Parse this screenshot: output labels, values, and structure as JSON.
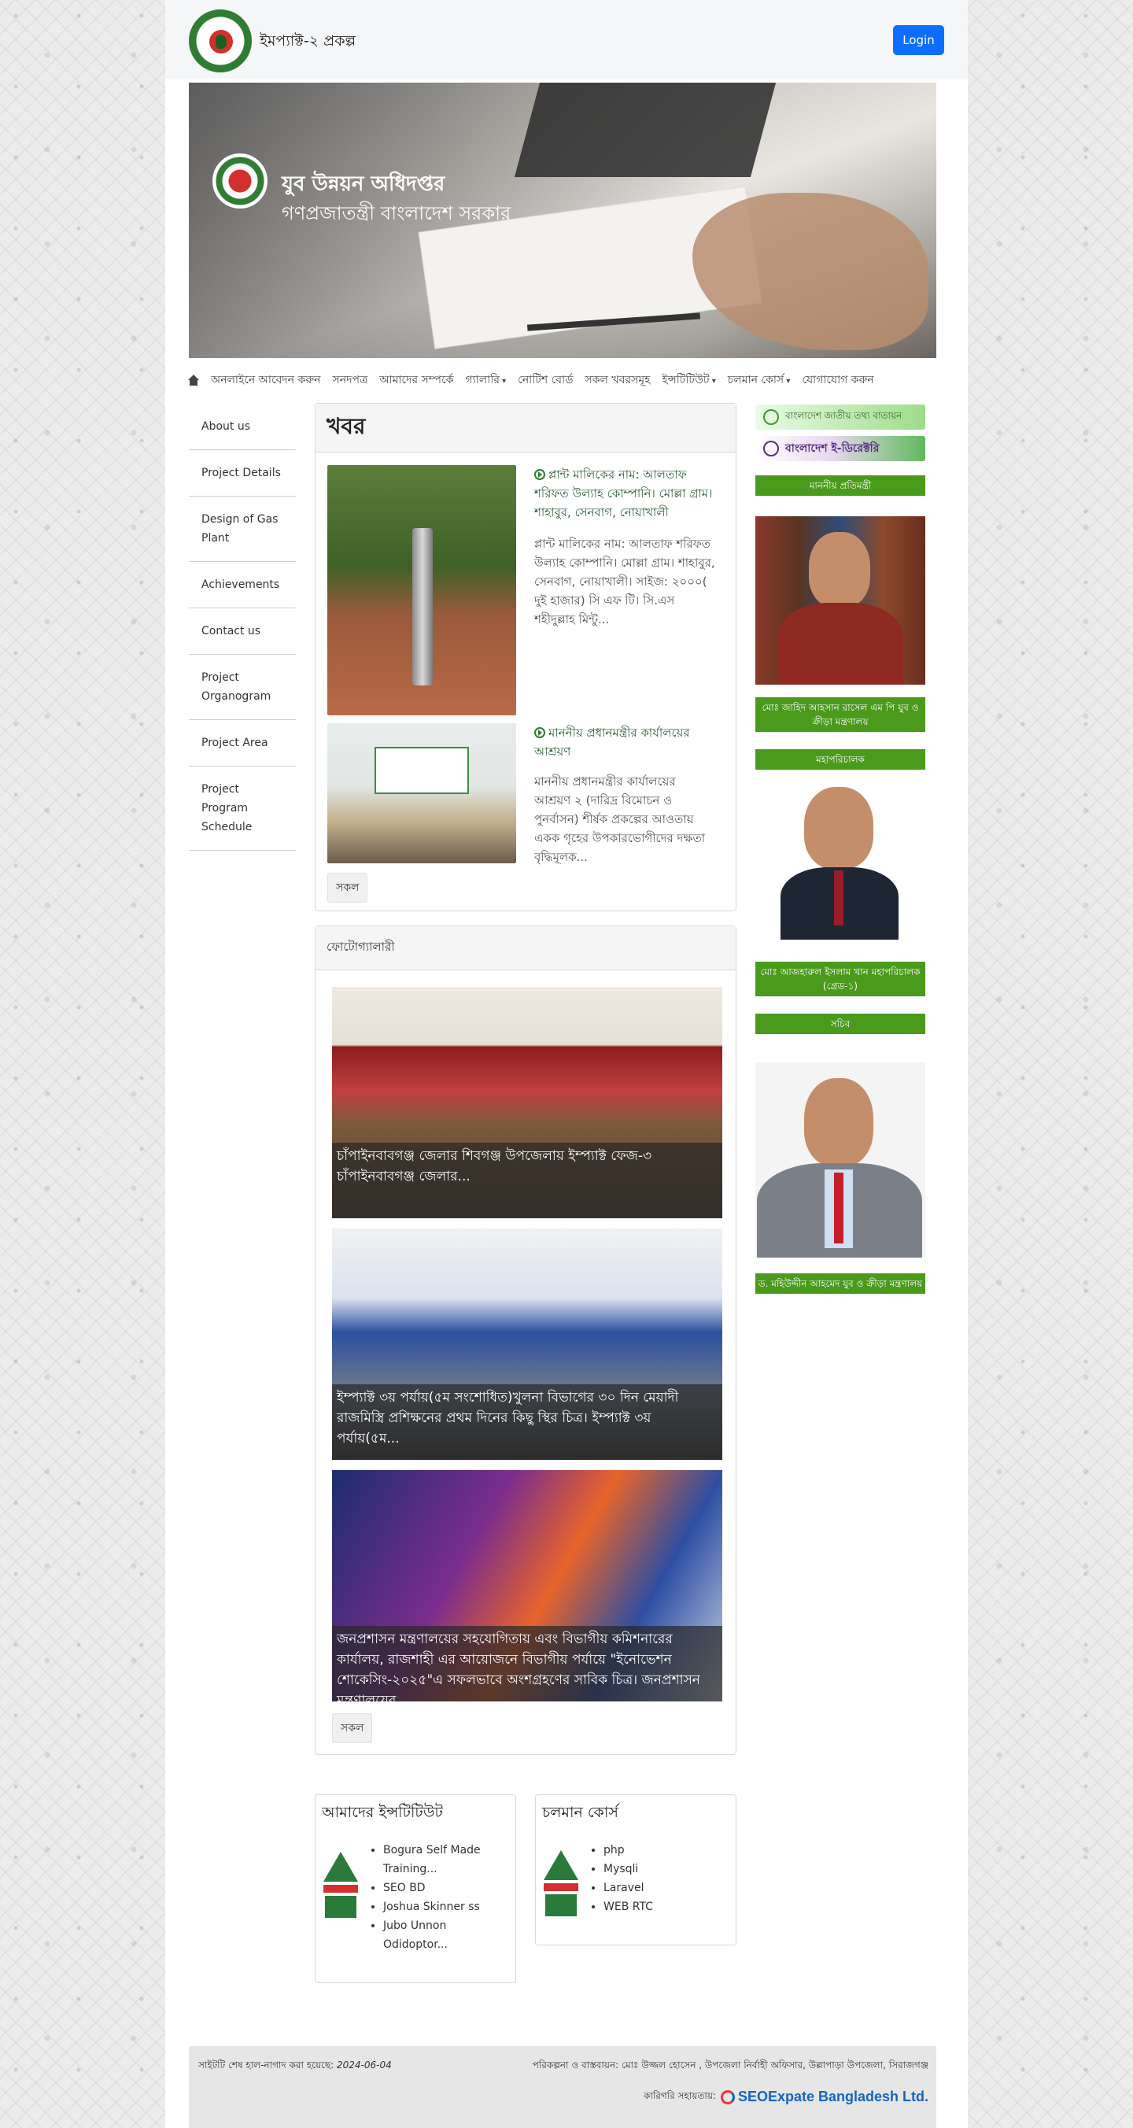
{
  "header": {
    "site_title": "ইমপ্যাক্ট-২ প্রকল্প",
    "login_label": "Login"
  },
  "banner": {
    "line1": "যুব উন্নয়ন অধিদপ্তর",
    "line2": "গণপ্রজাতন্ত্রী বাংলাদেশ সরকার"
  },
  "nav": {
    "items": [
      {
        "label": "অনলাইনে আবেদন করুন",
        "dropdown": false
      },
      {
        "label": "সনদপত্র",
        "dropdown": false
      },
      {
        "label": "আমাদের সম্পর্কে",
        "dropdown": false
      },
      {
        "label": "গ্যালারি",
        "dropdown": true
      },
      {
        "label": "নোটিশ বোর্ড",
        "dropdown": false
      },
      {
        "label": "সকল খবরসমূহ",
        "dropdown": false
      },
      {
        "label": "ইন্সটিটিউট",
        "dropdown": true
      },
      {
        "label": "চলমান কোর্স",
        "dropdown": true
      },
      {
        "label": "যোগাযোগ করুন",
        "dropdown": false
      }
    ]
  },
  "sidebar": {
    "items": [
      {
        "label": "About us"
      },
      {
        "label": "Project Details"
      },
      {
        "label": "Design of Gas Plant"
      },
      {
        "label": "Achievements"
      },
      {
        "label": "Contact us"
      },
      {
        "label": "Project Organogram"
      },
      {
        "label": "Project Area"
      },
      {
        "label": "Project Program Schedule"
      }
    ]
  },
  "news": {
    "heading": "খবর",
    "items": [
      {
        "title": "প্লান্ট মালিকের নাম: আলতাফ শরিফত উল্যাহ কোম্পানি। মোল্লা গ্রাম। শাহাবুর, সেনবাগ, নোয়াখালী",
        "body": "প্লান্ট মালিকের নাম: আলতাফ শরিফত উল্যাহ কোম্পানি। মোল্লা গ্রাম। শাহাবুর, সেনবাগ, নোয়াখালী। সাইজ: ২০০০( দুই হাজার) সি এফ টি। সি.এস শহীদুল্লাহ মিন্টু..."
      },
      {
        "title": "মাননীয় প্রধানমন্ত্রীর কার্যালয়ের আশ্রয়ণ",
        "body": "মাননীয় প্রধানমন্ত্রীর কার্যালয়ের আশ্রয়ণ ২ (দারিদ্র বিমোচন ও পুনর্বাসন) শীর্ষক প্রকল্পের আওতায় একক গৃহের উপকারভোগীদের দক্ষতা বৃদ্ধিমূলক..."
      }
    ],
    "more_label": "সকল"
  },
  "gallery": {
    "heading": "ফোটোগ্যালারী",
    "items": [
      {
        "caption": "চাঁপাইনবাবগঞ্জ জেলার শিবগঞ্জ উপজেলায় ইম্প্যাক্ট ফেজ-৩ চাঁপাইনবাবগঞ্জ জেলার..."
      },
      {
        "caption": "ইম্প্যাক্ট ৩য় পর্যায়(৫ম সংশোধিত)খুলনা বিভাগের ৩০ দিন মেয়াদী রাজমিস্ত্রি প্রশিক্ষনের প্রথম দিনের কিছু স্থির চিত্র। ইম্প্যাক্ট ৩য় পর্যায়(৫ম..."
      },
      {
        "caption": "জনপ্রশাসন মন্ত্রণালয়ের সহযোগিতায় এবং বিভাগীয় কমিশনারের কার্যালয়, রাজশাহী এর আয়োজনে বিভাগীয় পর্যায়ে \"ইনোভেশন শোকেসিং-২০২৫\"এ সফলভাবে অংশগ্রহণের সাবিক চিত্র। জনপ্রশাসন মন্ত্রণালয়ের..."
      }
    ],
    "more_label": "সকল"
  },
  "right_panel": {
    "banner1": "বাংলাদেশ জাতীয় তথ্য বাতায়ন",
    "banner2": "বাংলাদেশ ই-ডিরেক্টরি",
    "label_minister": "মাননীয় প্রতিমন্ত্রী",
    "minister_name": "মোঃ জাহিদ আহসান রাসেল এম পি যুব ও ক্রীড়া মন্ত্রণালয়",
    "label_dg": "মহাপরিচালক",
    "dg_name": "মোঃ আজহারুল ইসলাম খান মহাপরিচালক (গ্রেড-১)",
    "label_secretary": "সচিব",
    "secretary_name": "ড. মহিউদ্দীন আহমেদ যুব ও ক্রীড়া মন্ত্রণালয়"
  },
  "institutes": {
    "heading": "আমাদের ইন্সটিটিউট",
    "items": [
      "Bogura Self Made Training...",
      "SEO BD",
      "Joshua Skinner ss",
      "Jubo Unnon Odidoptor..."
    ]
  },
  "courses": {
    "heading": "চলমান কোর্স",
    "items": [
      "php",
      "Mysqli",
      "Laravel",
      "WEB RTC"
    ]
  },
  "footer": {
    "updated_label": "সাইটটি শেষ হাল-নাগাদ করা হয়েছে:",
    "updated_date": "2024-06-04",
    "credit": "পরিকল্পনা ও বাস্তবায়ন: মোঃ উজ্জল হোসেন , উপজেলা নির্বাহী অফিসার, উল্লাপাড়া উপজেলা,  সিরাজগঞ্জ",
    "tech_label": "কারিগরি সহায়তায়:",
    "tech_brand": "SEOExpate Bangladesh Ltd."
  },
  "colors": {
    "accent_green": "#4a9a1c",
    "login_blue": "#0d6efd",
    "news_link": "#2e5e3a"
  }
}
